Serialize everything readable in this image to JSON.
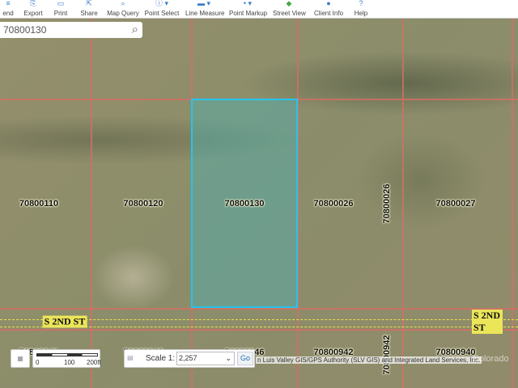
{
  "toolbar": {
    "items": [
      {
        "label": "end",
        "icon": "legend-icon"
      },
      {
        "label": "Export",
        "icon": "export-icon"
      },
      {
        "label": "Print",
        "icon": "printer-icon"
      },
      {
        "label": "Share",
        "icon": "share-icon"
      },
      {
        "label": "Map Query",
        "icon": "magnifier-icon"
      },
      {
        "label": "Point Select",
        "icon": "info-icon"
      },
      {
        "label": "Line Measure",
        "icon": "ruler-icon"
      },
      {
        "label": "Point Markup",
        "icon": "pin-icon"
      },
      {
        "label": "Street View",
        "icon": "street-view-icon"
      },
      {
        "label": "Client Info",
        "icon": "user-icon"
      },
      {
        "label": "Help",
        "icon": "help-icon"
      }
    ]
  },
  "search": {
    "value": "70800130"
  },
  "parcels": [
    "70800110",
    "70800120",
    "70800130",
    "70800026",
    "70800026",
    "70800027",
    "70800941",
    "70800943",
    "70800946",
    "70800942",
    "70800942",
    "70800940"
  ],
  "selected_parcel": "70800130",
  "road": "S 2ND ST",
  "scalebar": {
    "ticks": [
      "0",
      "100",
      "200ft"
    ]
  },
  "scale": {
    "label": "Scale 1:",
    "value": "2,257",
    "go": "Go"
  },
  "attribution": "n Luis Valley GIS/GPS Authority (SLV GIS) and Integrated Land Services, Inc.",
  "watermark": "Colorado",
  "colors": {
    "selection": "#25c4f0",
    "parcel_lines": "#d66e64",
    "road": "#ebe55a"
  }
}
